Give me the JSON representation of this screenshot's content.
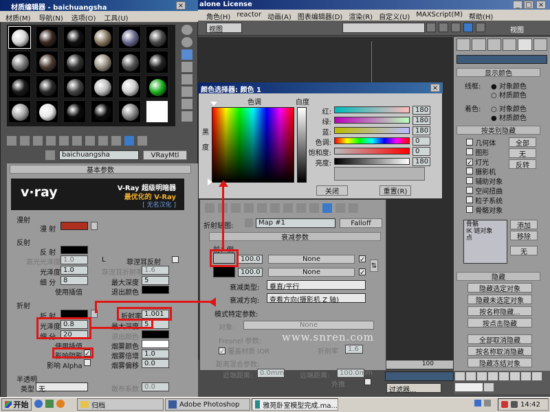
{
  "app": {
    "title_right": "alone License",
    "menu": [
      "角色(H)",
      "reactor",
      "动画(A)",
      "图表编辑器(D)",
      "渲染(R)",
      "自定义(U)",
      "MAXScript(M)",
      "帮助(H)"
    ],
    "viewport_label": "视图",
    "viewport_label_right": "视图"
  },
  "material_editor": {
    "title": "材质编辑器 - baichuangsha",
    "menu": [
      "材质(M)",
      "导航(N)",
      "选项(O)",
      "工具(U)"
    ],
    "material_name": "baichuangsha",
    "material_type": "VRayMtl",
    "section_basic": "基本参数",
    "vray_banner": {
      "logo": "v·ray",
      "line1": "V-Ray 超级明暗器",
      "line2": "最优化的 V-Ray",
      "line3": "[ 无名汉化 ]"
    },
    "diffuse": {
      "group": "漫射",
      "label": "漫 射"
    },
    "reflect": {
      "group": "反射",
      "label": "反 射",
      "hilight_label": "高光光泽度",
      "hilight_value": "1.0",
      "l_label": "L",
      "fresnel_label": "菲涅耳反射",
      "gloss_label": "光泽度",
      "gloss_value": "1.0",
      "fresnel_ior_label": "菲涅耳折射率",
      "fresnel_ior_value": "1.6",
      "subdivs_label": "细 分",
      "subdivs_value": "8",
      "max_depth_label": "最大深度",
      "max_depth_value": "5",
      "use_interp_label": "使用插值",
      "exit_color_label": "退出颜色"
    },
    "refract": {
      "group": "折射",
      "label": "折 射",
      "ior_label": "折射率",
      "ior_value": "1.001",
      "gloss_label": "光泽度",
      "gloss_value": "0.8",
      "max_depth_label": "最大深度",
      "max_depth_value": "5",
      "subdivs_label": "细 分",
      "subdivs_value": "20",
      "exit_color_label": "退出颜色",
      "use_interp_label": "使用插值",
      "fog_color_label": "烟雾颜色",
      "affect_shadows_label": "影响阴影",
      "fog_mult_label": "烟雾倍增",
      "fog_mult_value": "1.0",
      "affect_alpha_label": "影响 Alpha",
      "fog_bias_label": "烟雾偏移",
      "fog_bias_value": "0.0"
    },
    "translucency": {
      "group": "半透明",
      "type_label": "类型",
      "type_value": "无",
      "scatter_label": "散布系数",
      "scatter_value": "0.0"
    }
  },
  "color_picker": {
    "title": "颜色选择器: 颜色 1",
    "hue_label": "色调",
    "white_label": "白度",
    "black_label": "黑",
    "degree_label": "度",
    "rows": [
      {
        "label": "红:",
        "value": "180"
      },
      {
        "label": "绿:",
        "value": "180"
      },
      {
        "label": "蓝:",
        "value": "180"
      },
      {
        "label": "色调:",
        "value": "0"
      },
      {
        "label": "饱和度:",
        "value": "0"
      },
      {
        "label": "亮度:",
        "value": "180"
      }
    ],
    "close_label": "关闭",
    "reset_label": "重置(R)"
  },
  "falloff": {
    "map_label": "折射贴图:",
    "map_value": "Map #1",
    "type_button": "Falloff",
    "section": "衰减参数",
    "front_side": "前：侧",
    "row1_value": "100.0",
    "row1_map": "None",
    "row2_value": "100.0",
    "row2_map": "None",
    "type_label": "衰减类型:",
    "type_value": "垂直/平行",
    "direction_label": "衰减方向:",
    "direction_value": "查看方向(摄影机 Z 轴)",
    "mode_section": "模式特定参数:",
    "object_label": "对象:",
    "object_value": "None",
    "fresnel_label": "Fresnel 参数:",
    "override_label": "覆盖材质 IOR",
    "ior_label": "折射率",
    "ior_value": "1.6",
    "distance_section": "距离混合参数:",
    "near_label": "近端距离:",
    "near_value": "0.0mm",
    "far_label": "远端距离:",
    "far_value": "100.0mm",
    "extrapolate_label": "外推"
  },
  "right_panel": {
    "display_color": "显示颜色",
    "wireframe_label": "线框:",
    "shaded_label": "着色:",
    "object_color": "对象颜色",
    "material_color": "材质颜色",
    "hide_by_category": "按类别隐藏",
    "categories": [
      "几何体",
      "图形",
      "灯光",
      "摄影机",
      "辅助对象",
      "空间扭曲",
      "粒子系统",
      "骨骼对象"
    ],
    "all_button": "全部",
    "none_button": "无",
    "invert_button": "反转",
    "list_items": [
      "骨骼",
      "IK 链对象",
      "点"
    ],
    "add_button": "添加",
    "remove_button": "移除",
    "none_button2": "无",
    "hide_section": "隐藏",
    "hide_buttons": [
      "隐藏选定对象",
      "隐藏未选定对象",
      "按名称隐藏...",
      "按点击隐藏",
      "全部取消隐藏",
      "按名称取消隐藏",
      "隐藏冻结对象"
    ]
  },
  "watermark": "www.snren.com",
  "timeline": {
    "frame_label": "100",
    "filter_label": "过滤器..."
  },
  "taskbar": {
    "start": "开始",
    "folder": "归档",
    "app1": "Adobe Photoshop",
    "app2": "雅苑卧室模型完成.ma...",
    "clock": "14:42"
  }
}
